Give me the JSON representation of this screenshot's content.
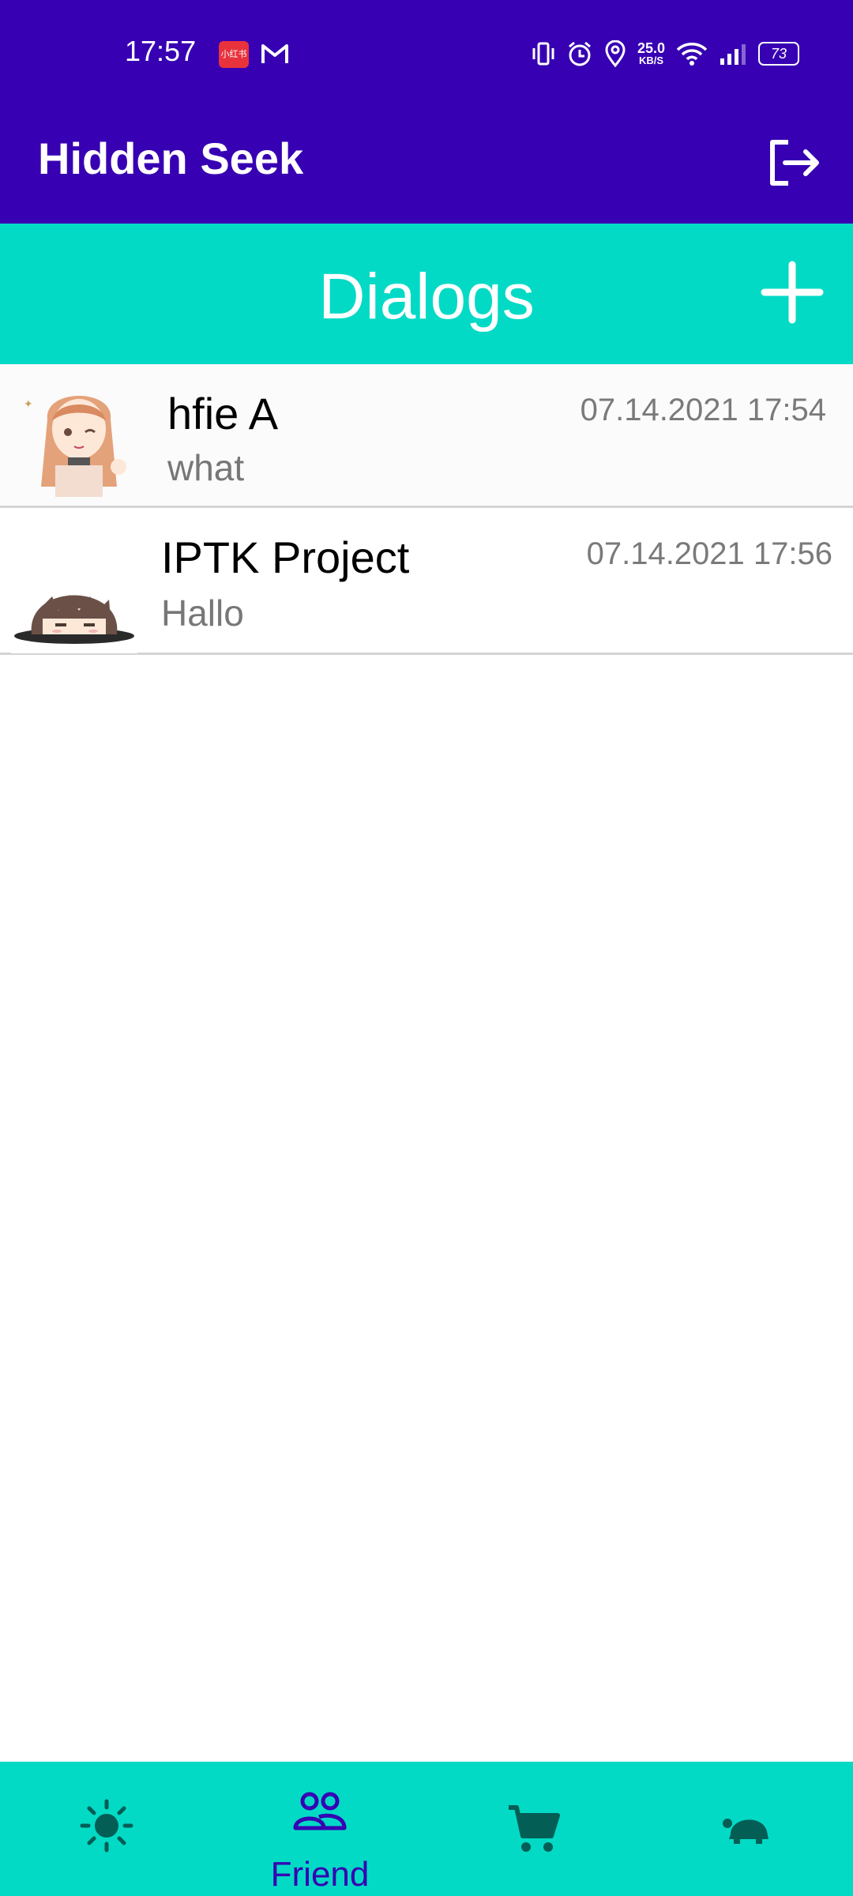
{
  "status_bar": {
    "time": "17:57",
    "app_badge": "小红书",
    "network_speed": "25.0",
    "network_unit": "KB/S",
    "battery": "73",
    "icons": [
      "gmail-icon",
      "vibrate-icon",
      "alarm-icon",
      "location-icon",
      "wifi-icon",
      "signal-icon",
      "battery-icon"
    ]
  },
  "app_bar": {
    "title": "Hidden Seek",
    "logout_icon": "logout-icon"
  },
  "header": {
    "title": "Dialogs",
    "add_icon": "plus-icon"
  },
  "dialogs": [
    {
      "name": "hfie A",
      "message": "what",
      "time": "07.14.2021 17:54",
      "avatar": "anime-girl-avatar"
    },
    {
      "name": "IPTK Project",
      "message": "Hallo",
      "time": "07.14.2021 17:56",
      "avatar": "anime-boy-avatar"
    }
  ],
  "bottom_nav": {
    "items": [
      {
        "icon": "sun-icon",
        "label": ""
      },
      {
        "icon": "people-icon",
        "label": "Friend",
        "selected": true
      },
      {
        "icon": "cart-icon",
        "label": ""
      },
      {
        "icon": "turtle-icon",
        "label": ""
      }
    ]
  },
  "colors": {
    "primary": "#3700B3",
    "accent": "#03DAC5",
    "nav_icon": "#035e56"
  }
}
